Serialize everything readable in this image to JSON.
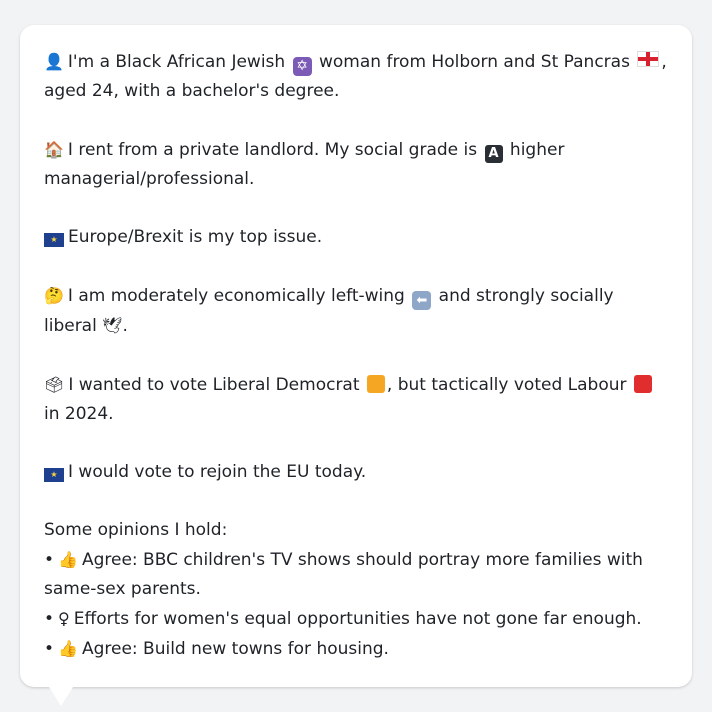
{
  "persona": {
    "p1": {
      "icon": "person-silhouette-icon",
      "before_star": "I'm a Black African Jewish",
      "star_icon": "star-of-david-icon",
      "star_glyph": "✡",
      "middle": "woman from Holborn and St Pancras",
      "flag_icon": "england-flag-icon",
      "after_flag": ", aged 24, with a bachelor's degree."
    },
    "p2": {
      "icon": "house-icon",
      "before_a": "I rent from a private landlord. My social grade is",
      "a_glyph": "A",
      "after_a": "higher managerial/professional."
    },
    "p3": {
      "icon": "eu-flag-icon",
      "text": "Europe/Brexit is my top issue."
    },
    "p4": {
      "icon": "thinking-face-icon",
      "before_arrow": "I am moderately economically left-wing",
      "arrow_glyph": "⬅",
      "after_arrow": "and strongly socially liberal",
      "dove_icon": "dove-icon",
      "end": "."
    },
    "p5": {
      "icon": "ballot-box-icon",
      "before_ld": "I wanted to vote Liberal Democrat",
      "ld_color": "#f5a623",
      "middle": ", but tactically voted Labour",
      "lab_color": "#e02e2e",
      "after_lab": "in 2024."
    },
    "p6": {
      "icon": "eu-flag-icon",
      "text": "I would vote to rejoin the EU today."
    },
    "opinions": {
      "heading": "Some opinions I hold:",
      "bullet": "•",
      "items": [
        {
          "icon": "thumbs-up-icon",
          "glyph": "👍",
          "text": "Agree: BBC children's TV shows should portray more families with same-sex parents."
        },
        {
          "icon": "female-sign-icon",
          "glyph": "♀",
          "text": "Efforts for women's equal opportunities have not gone far enough."
        },
        {
          "icon": "thumbs-up-icon",
          "glyph": "👍",
          "text": "Agree: Build new towns for housing."
        }
      ]
    }
  },
  "glyphs": {
    "person": "👤",
    "house": "🏠",
    "thinking": "🤔",
    "dove": "🕊",
    "ballot": "🗳",
    "eu_stars": "★"
  }
}
